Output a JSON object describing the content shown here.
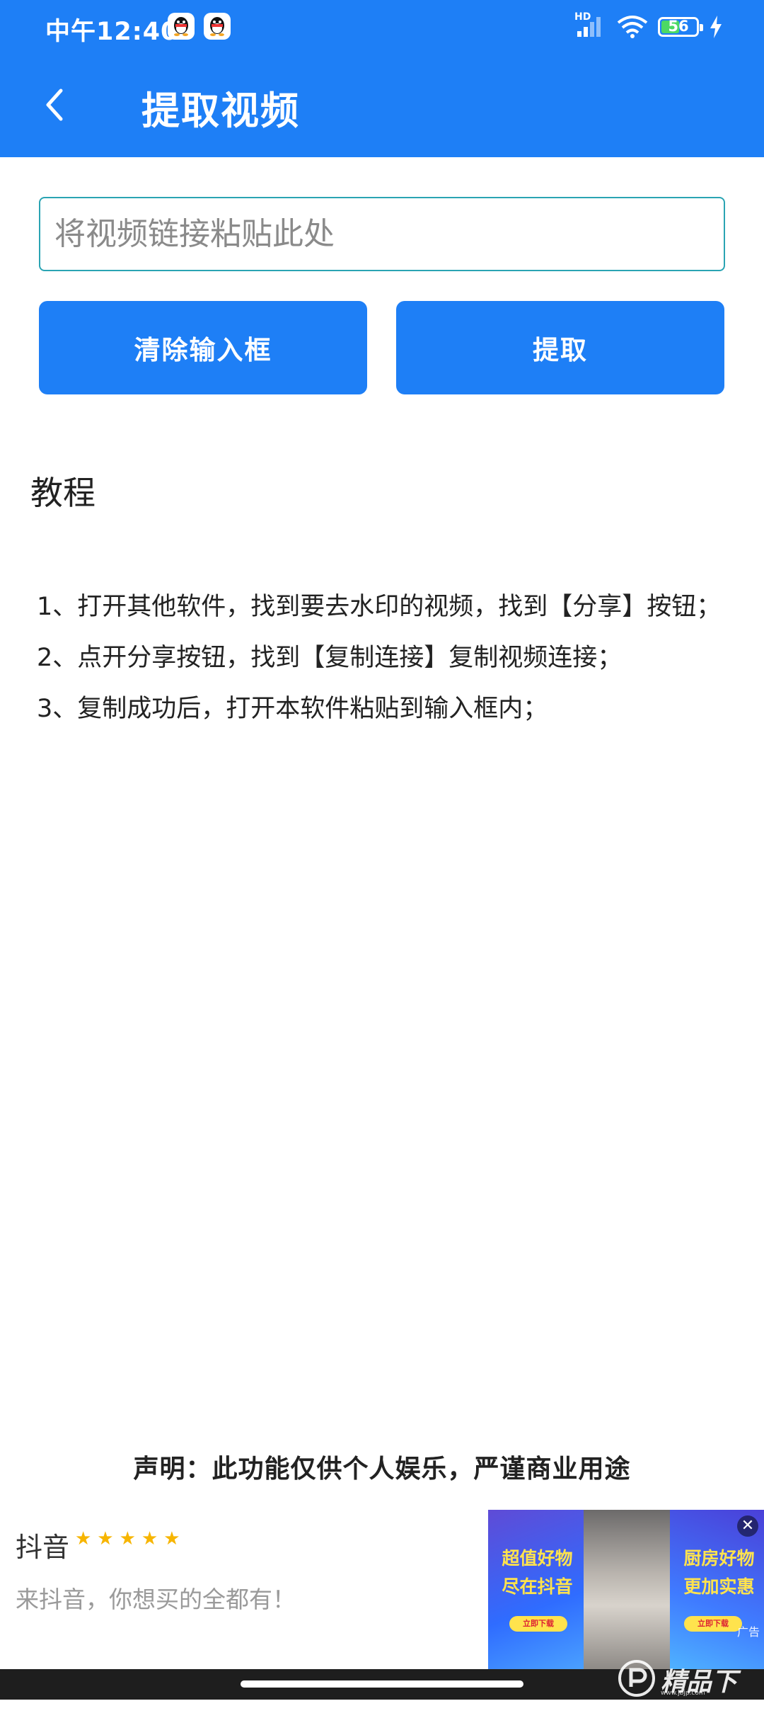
{
  "status_bar": {
    "time": "中午12:40",
    "network": "HD",
    "battery": "56",
    "battery_level": 0.56
  },
  "header": {
    "title": "提取视频"
  },
  "input": {
    "placeholder": "将视频链接粘贴此处"
  },
  "buttons": {
    "clear": "清除输入框",
    "extract": "提取"
  },
  "tutorial": {
    "title": "教程",
    "steps": [
      "1、打开其他软件，找到要去水印的视频，找到【分享】按钮；",
      "2、点开分享按钮，找到【复制连接】复制视频连接；",
      "3、复制成功后，打开本软件粘贴到输入框内；"
    ]
  },
  "disclaimer": "声明：此功能仅供个人娱乐，严谨商业用途",
  "ad": {
    "app_name": "抖音",
    "stars": "★★★★★",
    "slogan": "来抖音，你想买的全都有！",
    "image1_line1": "超值好物",
    "image1_line2": "尽在抖音",
    "image1_cta": "立即下载",
    "image3_line1": "厨房好物",
    "image3_line2": "更加实惠",
    "image3_cta": "立即下载",
    "close": "✕",
    "tag": "广告"
  },
  "watermark": {
    "brand": "精品下载",
    "url": "www.jbjp.com"
  },
  "colors": {
    "primary": "#1e7ff6",
    "input_border": "#2aa4b3"
  }
}
